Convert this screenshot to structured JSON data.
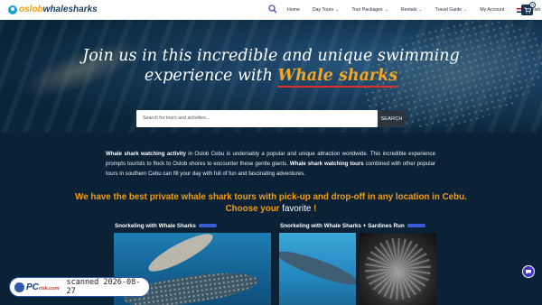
{
  "header": {
    "logo": {
      "part_a": "oslob",
      "part_b": "whalesharks"
    },
    "search_icon": "search-icon",
    "nav": [
      {
        "label": "Home",
        "dropdown": false
      },
      {
        "label": "Day Tours",
        "dropdown": true
      },
      {
        "label": "Tour Packages",
        "dropdown": true
      },
      {
        "label": "Rentals",
        "dropdown": true
      },
      {
        "label": "Travel Guide",
        "dropdown": true
      },
      {
        "label": "My Account",
        "dropdown": false
      }
    ],
    "language": "English",
    "cart_count": "0"
  },
  "hero": {
    "title_line1": "Join us in this incredible and unique swimming",
    "title_line2": "experience with",
    "title_accent": "Whale sharks",
    "search_placeholder": "Search for tours and activities...",
    "search_button": "SEARCH"
  },
  "intro": {
    "b1": "Whale shark watching activity",
    "t1": " in Oslob Cebu is undeniably a popular and unique attraction worldwide. This incredible experience prompts tourists to flock to Oslob shores to encounter these gentle giants. ",
    "b2": "Whale shark watching tours",
    "t2": " combined with other popular tours in southern Cebu can fill your day with full of fun and fascinating adventures."
  },
  "offer": {
    "line1": "We have the best private whale shark tours with pick-up and drop-off in any location in Cebu.",
    "line2_a": "Choose your",
    "line2_fav": "favorite",
    "line2_end": "!"
  },
  "cards": [
    {
      "title": "Snorkeling with Whale Sharks"
    },
    {
      "title": "Snorkeling with Whale Sharks + Sardines Run"
    }
  ],
  "stamp": {
    "brand": "PC",
    "brand_small": "risk.com",
    "text": "scanned 2026-08-27"
  },
  "colors": {
    "accent": "#f39c12",
    "navy": "#0b2236",
    "underline": "#e0302b"
  }
}
